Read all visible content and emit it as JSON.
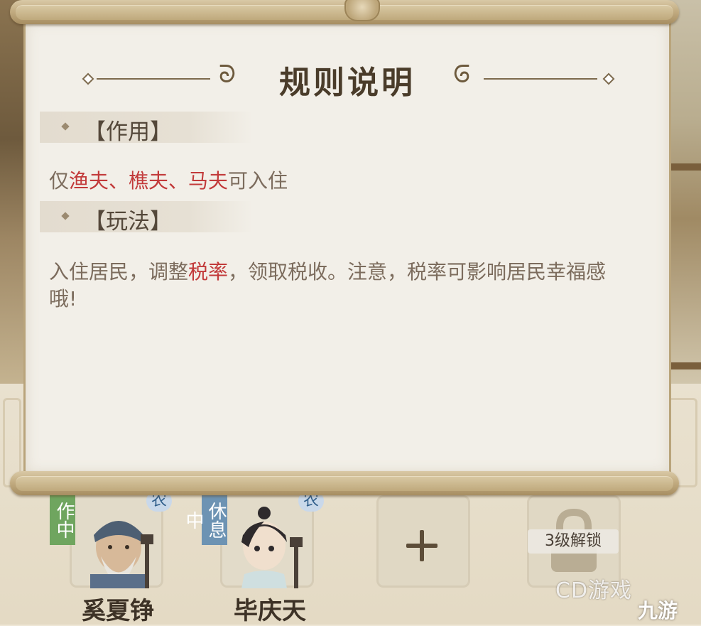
{
  "dialog": {
    "title": "规则说明",
    "sections": [
      {
        "header": "【作用】",
        "body": [
          {
            "text": "仅",
            "highlight": false
          },
          {
            "text": "渔夫、樵夫、马夫",
            "highlight": true
          },
          {
            "text": "可入住",
            "highlight": false
          }
        ]
      },
      {
        "header": "【玩法】",
        "body": [
          {
            "text": "入住居民，调整",
            "highlight": false
          },
          {
            "text": "税率",
            "highlight": true
          },
          {
            "text": "，领取税收。注意，税率可影响居民幸福感哦!",
            "highlight": false
          }
        ]
      }
    ]
  },
  "residents": [
    {
      "name": "奚夏铮",
      "status": "工作中",
      "status_visible": "作中",
      "job": "农"
    },
    {
      "name": "毕庆天",
      "status": "休息中",
      "status_visible": "休息中",
      "job": "农"
    }
  ],
  "slots": {
    "add_icon": "plus-icon",
    "locked_label": "3级解锁",
    "lock_icon": "lock-icon"
  },
  "watermarks": {
    "cd": "CD游戏",
    "jiuyou": "九游"
  },
  "colors": {
    "highlight": "#c23a3a",
    "body_text": "#7c6c5d",
    "working_badge": "#6fa55f",
    "resting_badge": "#6d93b3"
  }
}
